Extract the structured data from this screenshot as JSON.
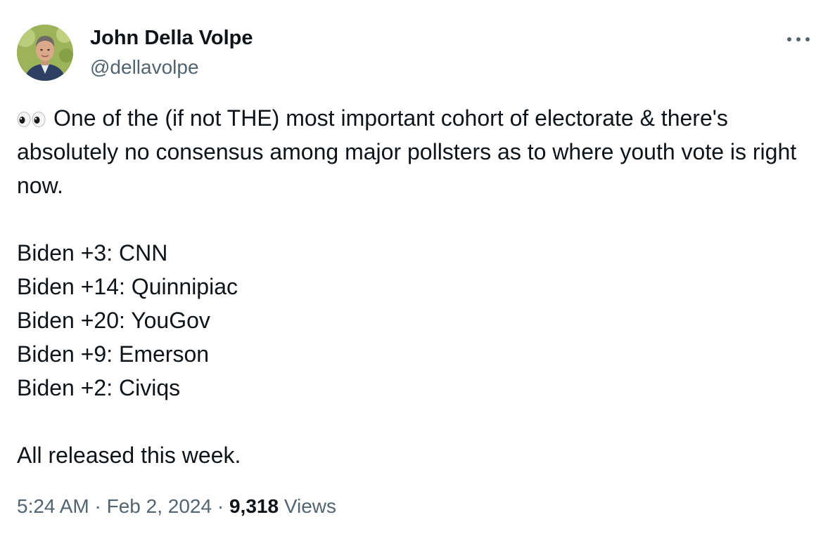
{
  "author": {
    "name": "John Della Volpe",
    "handle": "@dellavolpe",
    "avatar_icon": "profile-photo"
  },
  "more_icon": "more-options-icon",
  "tweet": {
    "lead_emoji": "eyes-emoji",
    "paragraph_1": "One of the (if not THE) most important cohort of electorate & there's absolutely no consensus among major pollsters as to where youth vote is right now.",
    "polls": [
      "Biden +3:  CNN",
      "Biden +14: Quinnipiac",
      "Biden +20: YouGov",
      "Biden +9: Emerson",
      "Biden +2: Civiqs"
    ],
    "closing": "All released this week."
  },
  "meta": {
    "time": "5:24 AM",
    "separator": " · ",
    "date": "Feb 2, 2024",
    "views_count": "9,318",
    "views_label": " Views"
  },
  "colors": {
    "text_primary": "#0f1419",
    "text_secondary": "#536471",
    "background": "#ffffff"
  }
}
